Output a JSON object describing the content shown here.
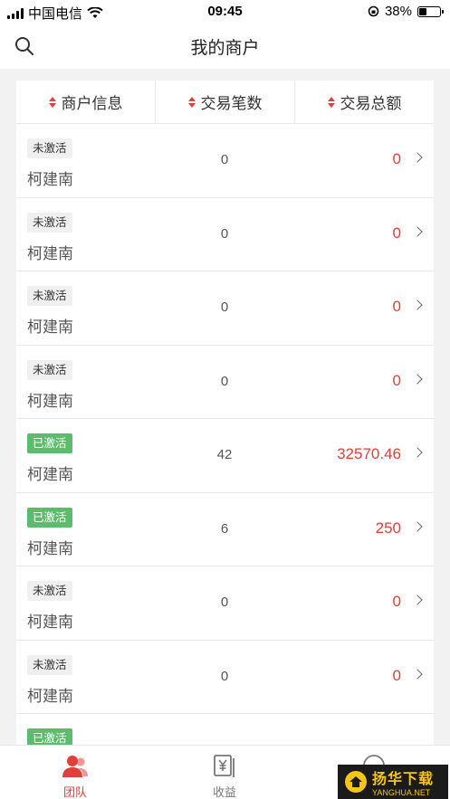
{
  "status_bar": {
    "carrier": "中国电信",
    "time": "09:45",
    "battery": "38%"
  },
  "nav": {
    "title": "我的商户"
  },
  "table": {
    "columns": [
      {
        "label": "商户信息"
      },
      {
        "label": "交易笔数"
      },
      {
        "label": "交易总额"
      }
    ],
    "rows": [
      {
        "status": "未激活",
        "status_type": "inactive",
        "name": "柯建南",
        "count": "0",
        "amount": "0"
      },
      {
        "status": "未激活",
        "status_type": "inactive",
        "name": "柯建南",
        "count": "0",
        "amount": "0"
      },
      {
        "status": "未激活",
        "status_type": "inactive",
        "name": "柯建南",
        "count": "0",
        "amount": "0"
      },
      {
        "status": "未激活",
        "status_type": "inactive",
        "name": "柯建南",
        "count": "0",
        "amount": "0"
      },
      {
        "status": "已激活",
        "status_type": "active",
        "name": "柯建南",
        "count": "42",
        "amount": "32570.46"
      },
      {
        "status": "已激活",
        "status_type": "active",
        "name": "柯建南",
        "count": "6",
        "amount": "250"
      },
      {
        "status": "未激活",
        "status_type": "inactive",
        "name": "柯建南",
        "count": "0",
        "amount": "0"
      },
      {
        "status": "未激活",
        "status_type": "inactive",
        "name": "柯建南",
        "count": "0",
        "amount": "0"
      },
      {
        "status": "已激活",
        "status_type": "active",
        "name": "",
        "count": "",
        "amount": ""
      }
    ]
  },
  "tab_bar": {
    "team_label": "团队",
    "income_label": "收益"
  },
  "watermark": {
    "cn": "扬华下载",
    "en": "YANGHUA.NET"
  },
  "colors": {
    "accent": "#e0403a",
    "active_tag": "#5bbd6b"
  }
}
